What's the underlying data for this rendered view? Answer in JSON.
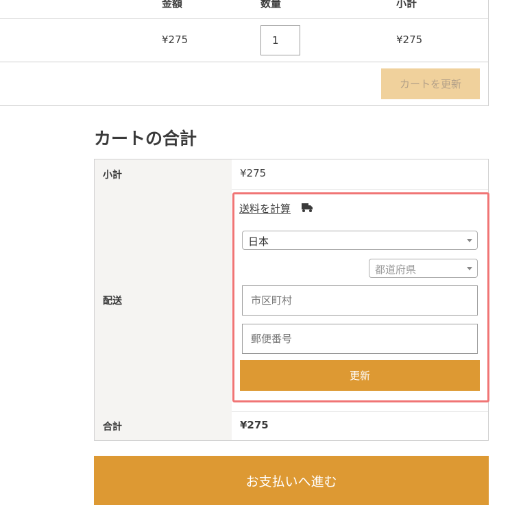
{
  "cart_table": {
    "headers": {
      "price": "金額",
      "quantity": "数量",
      "subtotal": "小計"
    },
    "row": {
      "price": "¥275",
      "quantity": "1",
      "subtotal": "¥275"
    },
    "update_cart_label": "カートを更新"
  },
  "totals": {
    "title": "カートの合計",
    "subtotal_label": "小計",
    "subtotal_value": "¥275",
    "shipping_label": "配送",
    "calc_shipping_label": "送料を計算",
    "country_value": "日本",
    "state_placeholder": "都道府県",
    "city_placeholder": "市区町村",
    "postcode_placeholder": "郵便番号",
    "update_label": "更新",
    "total_label": "合計",
    "total_value": "¥275"
  },
  "checkout": {
    "label": "お支払いへ進む"
  },
  "colors": {
    "accent": "#dd9933",
    "accent_disabled": "#f0d19c",
    "highlight_border": "#f07575",
    "label_background": "#f5f4f2"
  },
  "icons": {
    "shipping": "truck-icon",
    "select_arrow": "chevron-down-icon"
  }
}
